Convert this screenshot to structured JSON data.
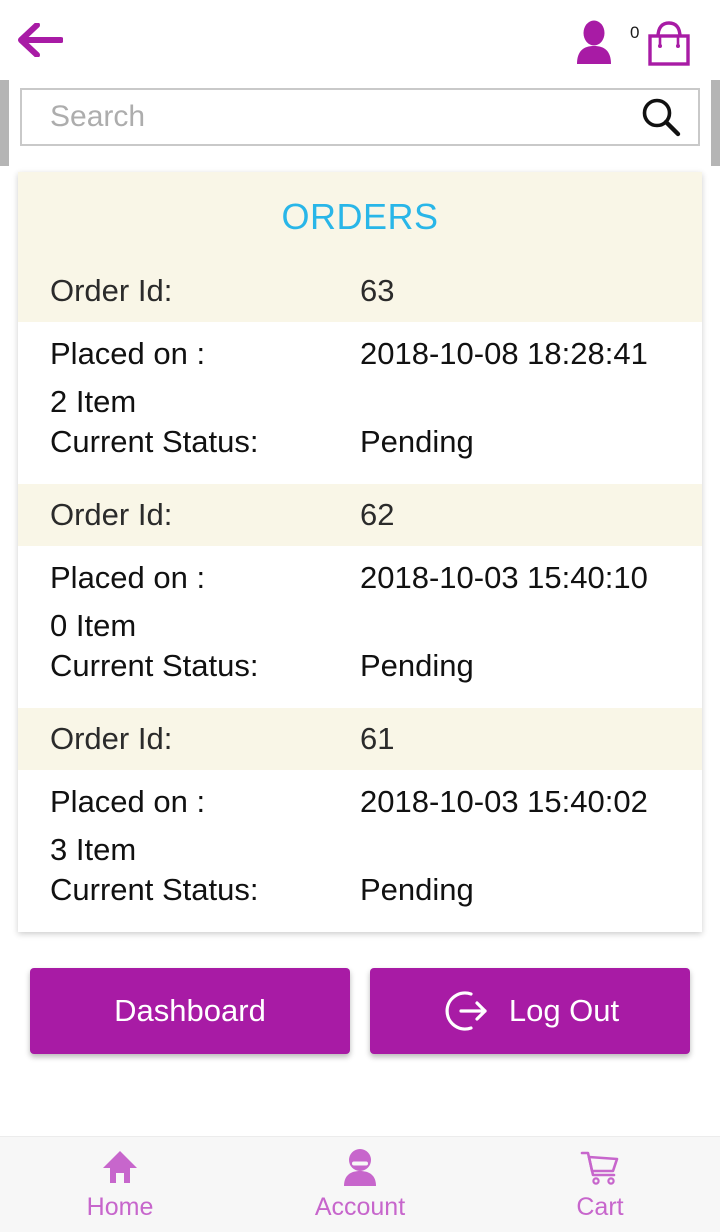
{
  "header": {
    "back_icon": "arrow-left-icon",
    "account_icon": "person-icon",
    "cart_icon": "shopping-bag-icon",
    "cart_count": "0"
  },
  "search": {
    "placeholder": "Search",
    "value": "",
    "icon": "search-icon"
  },
  "orders_card": {
    "title": "ORDERS",
    "labels": {
      "order_id": "Order Id:",
      "placed_on": "Placed on :",
      "current_status": "Current Status:"
    },
    "orders": [
      {
        "id": "63",
        "placed_on": "2018-10-08 18:28:41",
        "items": "2 Item",
        "status": "Pending"
      },
      {
        "id": "62",
        "placed_on": "2018-10-03 15:40:10",
        "items": "0 Item",
        "status": "Pending"
      },
      {
        "id": "61",
        "placed_on": "2018-10-03 15:40:02",
        "items": "3 Item",
        "status": "Pending"
      }
    ]
  },
  "actions": {
    "dashboard_label": "Dashboard",
    "logout_label": "Log Out",
    "logout_icon": "logout-arrow-icon"
  },
  "bottom_nav": {
    "items": [
      {
        "label": "Home",
        "icon": "home-icon"
      },
      {
        "label": "Account",
        "icon": "person-icon"
      },
      {
        "label": "Cart",
        "icon": "shopping-cart-icon"
      }
    ]
  },
  "colors": {
    "brand_purple": "#A81BA5",
    "nav_purple": "#C766CC",
    "title_cyan": "#29B6E8",
    "cream_row": "#F9F6E7"
  }
}
